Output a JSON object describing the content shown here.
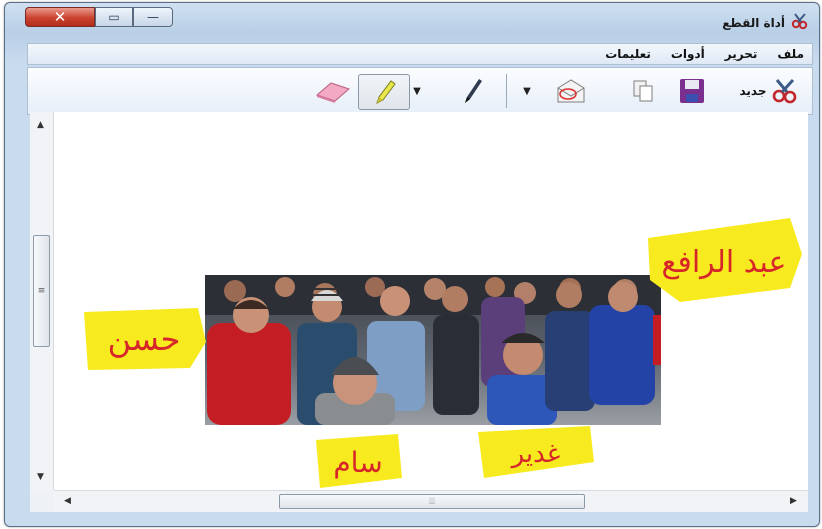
{
  "app": {
    "title": "أداة القطع",
    "icon": "scissors-icon"
  },
  "caption_buttons": {
    "close": "✕",
    "maximize": "▭",
    "minimize": "—"
  },
  "menu": [
    "ملف",
    "تحرير",
    "أدوات",
    "تعليمات"
  ],
  "toolbar": {
    "new_label": "جديد"
  },
  "scroll": {
    "grip": "≡",
    "hgrip": "⦙⦙⦙",
    "up": "▲",
    "down": "▼",
    "left": "◀",
    "right": "▶"
  },
  "annotations": [
    {
      "text": "عبد الرافع"
    },
    {
      "text": "حسن"
    },
    {
      "text": "سام"
    },
    {
      "text": "غدير"
    }
  ],
  "colors": {
    "highlighter": "#f7ea1e",
    "ink": "#d7262a",
    "title_bar": "#c5d8ed"
  }
}
